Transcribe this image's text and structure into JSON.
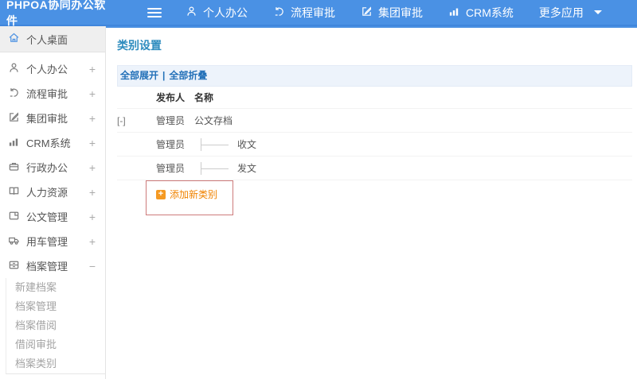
{
  "topbar": {
    "logo": "PHPOA协同办公软件",
    "nav": [
      {
        "label": "个人办公",
        "icon": "user-icon"
      },
      {
        "label": "流程审批",
        "icon": "flow-icon"
      },
      {
        "label": "集团审批",
        "icon": "edit-icon"
      },
      {
        "label": "CRM系统",
        "icon": "chart-icon"
      },
      {
        "label": "更多应用",
        "icon": "caret-down-icon"
      }
    ]
  },
  "sidebar": {
    "desktop": {
      "label": "个人桌面",
      "icon": "home-icon"
    },
    "items": [
      {
        "label": "个人办公",
        "toggle": "+",
        "icon": "user-icon"
      },
      {
        "label": "流程审批",
        "toggle": "+",
        "icon": "flow-icon"
      },
      {
        "label": "集团审批",
        "toggle": "+",
        "icon": "edit-icon"
      },
      {
        "label": "CRM系统",
        "toggle": "+",
        "icon": "chart-icon"
      },
      {
        "label": "行政办公",
        "toggle": "+",
        "icon": "briefcase-icon"
      },
      {
        "label": "人力资源",
        "toggle": "+",
        "icon": "book-icon"
      },
      {
        "label": "公文管理",
        "toggle": "+",
        "icon": "document-icon"
      },
      {
        "label": "用车管理",
        "toggle": "+",
        "icon": "truck-icon"
      },
      {
        "label": "档案管理",
        "toggle": "−",
        "icon": "archive-icon"
      }
    ],
    "submenu": [
      "新建档案",
      "档案管理",
      "档案借阅",
      "借阅审批",
      "档案类别"
    ]
  },
  "content": {
    "title": "类别设置",
    "toolbar": {
      "expand_all": "全部展开",
      "divider": "|",
      "collapse_all": "全部折叠"
    },
    "table": {
      "headers": {
        "publisher": "发布人",
        "name": "名称"
      },
      "rows": [
        {
          "toggle": "[-]",
          "publisher": "管理员",
          "name": "公文存档"
        },
        {
          "toggle": "",
          "publisher": "管理员",
          "name": "收文"
        },
        {
          "toggle": "",
          "publisher": "管理员",
          "name": "发文"
        }
      ],
      "add_label": "添加新类别"
    }
  },
  "colors": {
    "topbar_blue": "#4a91e4",
    "title_blue": "#2e8cbe",
    "link_blue": "#2270b8",
    "orange_icon": "#f59a23",
    "orange_text": "#f08300",
    "annotation_red": "#cd7b7b"
  }
}
